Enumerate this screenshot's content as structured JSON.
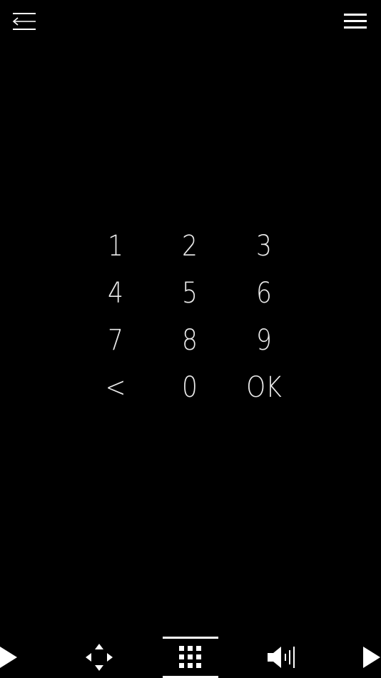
{
  "header": {
    "back_icon": "back-arrow-icon",
    "menu_icon": "hamburger-menu-icon"
  },
  "keypad": {
    "keys": [
      "1",
      "2",
      "3",
      "4",
      "5",
      "6",
      "7",
      "8",
      "9",
      "<",
      "0",
      "OK"
    ]
  },
  "bottom_nav": {
    "items": [
      {
        "icon": "play-left-icon"
      },
      {
        "icon": "dpad-icon"
      },
      {
        "icon": "keypad-grid-icon",
        "active": true
      },
      {
        "icon": "volume-icon"
      },
      {
        "icon": "play-right-icon"
      }
    ]
  },
  "colors": {
    "background": "#000000",
    "foreground": "#ffffff"
  }
}
